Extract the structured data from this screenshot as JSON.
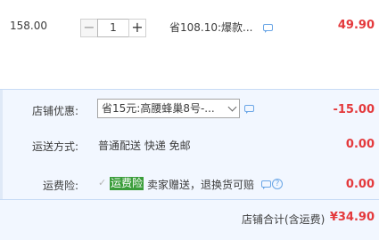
{
  "item": {
    "unit_price": "158.00",
    "quantity": "1",
    "minus_label": "−",
    "plus_label": "+",
    "promo_text": "省108.10:爆款...",
    "subtotal": "49.90"
  },
  "shop_discount": {
    "label": "店铺优惠:",
    "selected": "省15元:高腰蜂巢8号-...",
    "amount": "-15.00"
  },
  "shipping": {
    "label": "运送方式:",
    "method": "普通配送 快递 免邮",
    "amount": "0.00"
  },
  "insurance": {
    "label": "运费险:",
    "tag": "运费险",
    "description": "卖家赠送，退换货可赔",
    "amount": "0.00"
  },
  "total": {
    "label": "店铺合计(含运费)",
    "amount": "¥34.90"
  },
  "colors": {
    "price_red": "#e4393c",
    "panel_bg": "#f2f7ff",
    "insurance_green": "#3a9d3a",
    "link_blue": "#6aa6e6"
  }
}
